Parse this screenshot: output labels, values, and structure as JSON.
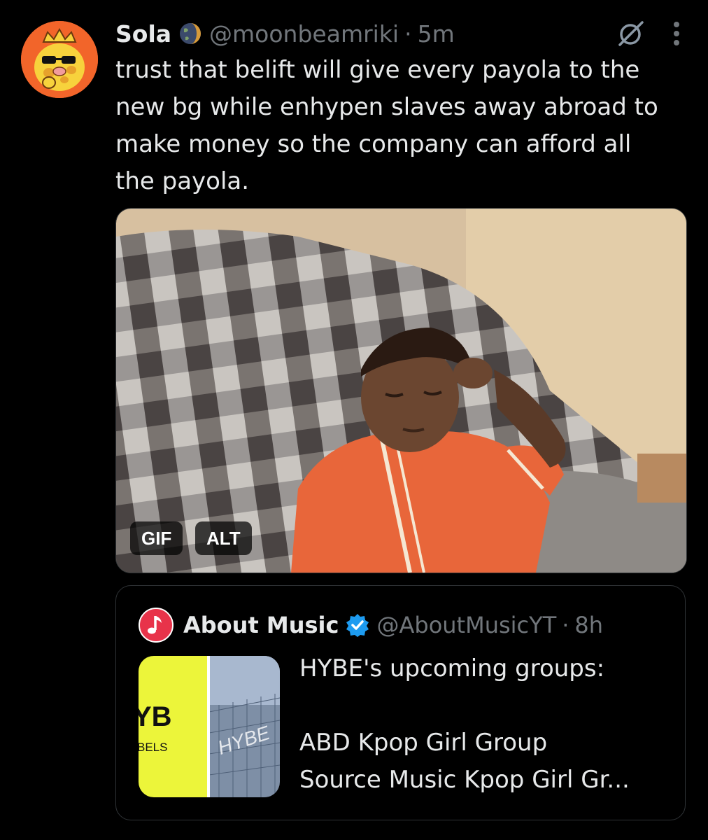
{
  "tweet": {
    "name": "Sola",
    "handle": "@moonbeamriki",
    "separator": "·",
    "time": "5m",
    "text_lines": [
      "trust that belift will give every payola to the",
      "new bg while enhypen slaves away abroad to",
      "make money so the company can afford all",
      "the payola."
    ],
    "avatar_icon": "yellow-cartoon-duck-avatar",
    "name_badge_icon": "globe-icon",
    "grok_icon": "grok-icon",
    "more_icon": "more-vertical-icon"
  },
  "media": {
    "gif_badge": "GIF",
    "alt_badge": "ALT"
  },
  "quote": {
    "name": "About Music",
    "handle": "@AboutMusicYT",
    "separator": "·",
    "time": "8h",
    "text_lines": [
      "HYBE's upcoming groups:",
      "",
      "ABD Kpop Girl Group",
      "Source Music Kpop Girl Gr..."
    ],
    "avatar_icon": "music-note-icon",
    "verified_icon": "verified-badge-icon",
    "thumb_left_text": "YB",
    "thumb_left_subtext": "BELS",
    "thumb_right_text": "HYBE"
  },
  "colors": {
    "background": "#000000",
    "text_primary": "#e7e9ea",
    "text_secondary": "#71767b",
    "border": "#2f3336",
    "verified_blue": "#1d9bf0",
    "music_red": "#e8334a",
    "hybe_yellow": "#ecf53a"
  }
}
